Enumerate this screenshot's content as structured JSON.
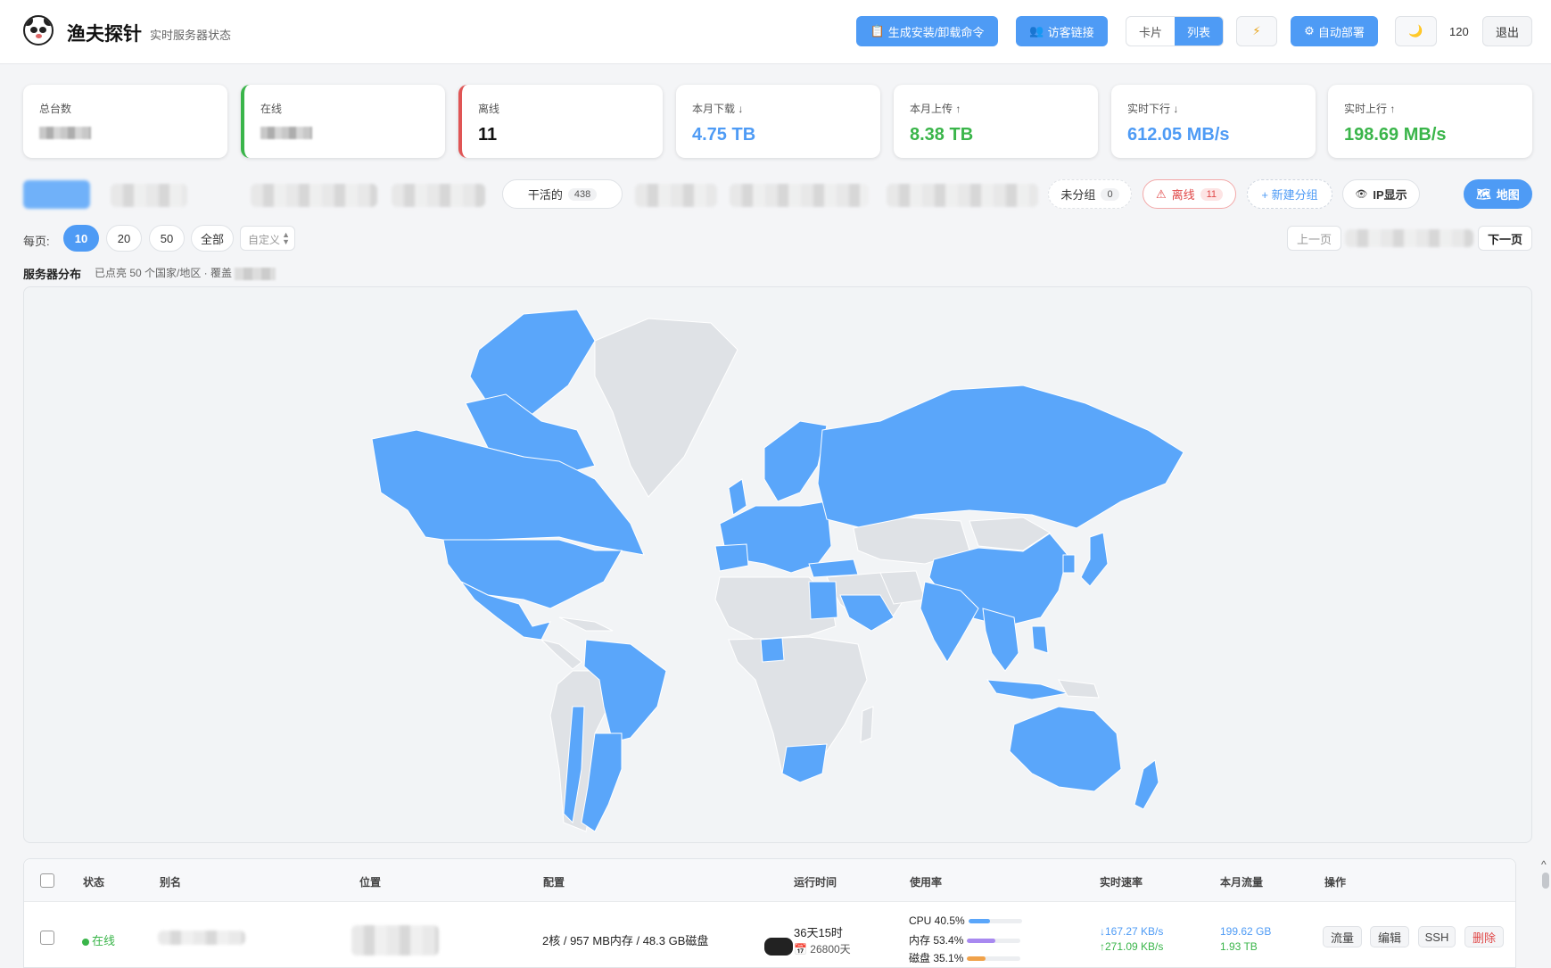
{
  "header": {
    "brand": "渔夫探针",
    "subtitle": "实时服务器状态",
    "install_btn": "生成安装/卸载命令",
    "visitor_btn": "访客链接",
    "view_card": "卡片",
    "view_list": "列表",
    "deploy_btn": "自动部署",
    "refresh_value": "120",
    "logout_btn": "退出"
  },
  "stats": {
    "total_label": "总台数",
    "online_label": "在线",
    "offline_label": "离线",
    "offline_value": "11",
    "month_down_label": "本月下载 ↓",
    "month_down_value": "4.75 TB",
    "month_up_label": "本月上传 ↑",
    "month_up_value": "8.38 TB",
    "rt_down_label": "实时下行 ↓",
    "rt_down_value": "612.05 MB/s",
    "rt_up_label": "实时上行 ↑",
    "rt_up_value": "198.69 MB/s"
  },
  "groups": {
    "working_label": "干活的",
    "working_count": "438",
    "ungrouped_label": "未分组",
    "ungrouped_count": "0",
    "offline_label": "离线",
    "offline_count": "11",
    "new_group": "+ 新建分组",
    "ip_toggle": "IP显示",
    "map_btn": "地图"
  },
  "paging": {
    "per_page_label": "每页:",
    "opt_10": "10",
    "opt_20": "20",
    "opt_50": "50",
    "opt_all": "全部",
    "custom_placeholder": "自定义",
    "prev": "上一页",
    "next": "下一页"
  },
  "distribution": {
    "title": "服务器分布",
    "subtitle": "已点亮 50 个国家/地区 · 覆盖"
  },
  "table": {
    "headers": [
      "状态",
      "别名",
      "位置",
      "配置",
      "运行时间",
      "使用率",
      "实时速率",
      "本月流量",
      "操作"
    ],
    "row": {
      "status": "在线",
      "config": "2核 / 957 MB内存 / 48.3 GB磁盘",
      "uptime": "36天15时",
      "expire": "26800天",
      "cpu": "CPU 40.5%",
      "mem": "内存 53.4%",
      "disk": "磁盘 35.1%",
      "cpu_pct": 40.5,
      "mem_pct": 53.4,
      "disk_pct": 35.1,
      "rate_down": "↓167.27 KB/s",
      "rate_up": "↑271.09 KB/s",
      "traffic_down": "199.62 GB",
      "traffic_up": "1.93 TB",
      "btn_traffic": "流量",
      "btn_edit": "编辑",
      "btn_ssh": "SSH",
      "btn_delete": "删除"
    }
  },
  "colors": {
    "accent": "#4e9bf5",
    "online": "#3ab54a",
    "offline": "#e05555",
    "map_lit": "#5aa6fa",
    "map_dim": "#dfe2e6"
  },
  "icons": {
    "logo": "panda-logo",
    "install": "clipboard-icon",
    "visitor": "people-icon",
    "power": "lightning-icon",
    "deploy": "gear-icon",
    "theme": "moon-icon",
    "offline": "warning-icon",
    "ip": "eye-icon",
    "map": "map-icon",
    "calendar": "calendar-icon"
  }
}
